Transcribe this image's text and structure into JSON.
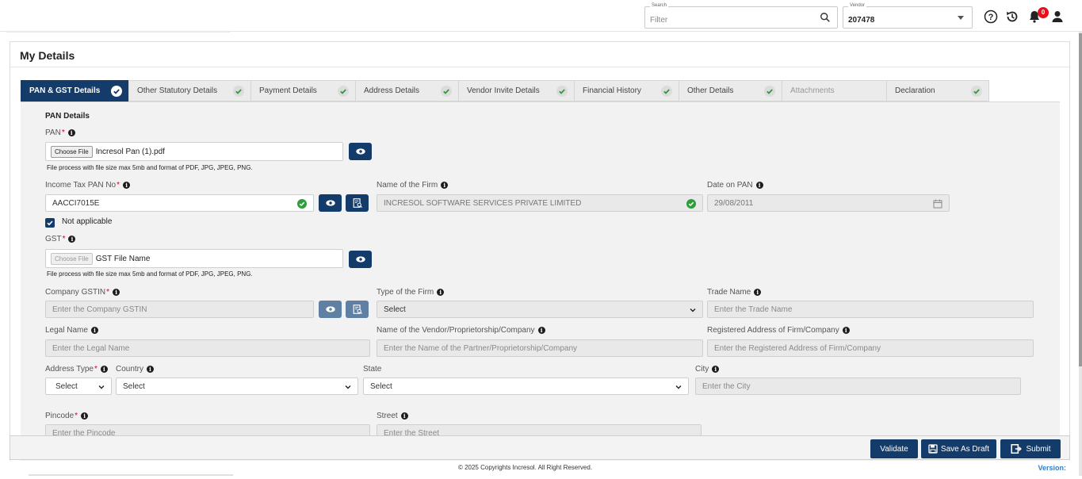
{
  "header": {
    "search": {
      "label": "Search",
      "placeholder": "Filter"
    },
    "vendor": {
      "label": "Vendor",
      "value": "207478"
    },
    "notification_count": "0"
  },
  "page": {
    "title": "My Details"
  },
  "tabs": [
    {
      "label": "PAN & GST Details",
      "state": "active"
    },
    {
      "label": "Other Statutory Details",
      "state": "done"
    },
    {
      "label": "Payment Details",
      "state": "done"
    },
    {
      "label": "Address Details",
      "state": "done"
    },
    {
      "label": "Vendor Invite Details",
      "state": "done"
    },
    {
      "label": "Financial History",
      "state": "done"
    },
    {
      "label": "Other Details",
      "state": "done"
    },
    {
      "label": "Attachments",
      "state": "disabled"
    },
    {
      "label": "Declaration",
      "state": "done"
    }
  ],
  "form": {
    "section_title": "PAN Details",
    "pan": {
      "label": "PAN",
      "choose_file": "Choose File",
      "file_name": "Incresol Pan (1).pdf",
      "hint": "File process with file size max 5mb and format of PDF, JPG, JPEG, PNG."
    },
    "income_tax_pan": {
      "label": "Income Tax PAN No",
      "value": "AACCI7015E"
    },
    "firm_name": {
      "label": "Name of the Firm",
      "value": "INCRESOL SOFTWARE SERVICES PRIVATE LIMITED"
    },
    "date_on_pan": {
      "label": "Date on PAN",
      "value": "29/08/2011"
    },
    "not_applicable": {
      "label": "Not applicable",
      "checked": true
    },
    "gst": {
      "label": "GST",
      "choose_file": "Choose File",
      "file_name": "GST File Name",
      "hint": "File process with file size max 5mb and format of PDF, JPG, JPEG, PNG."
    },
    "company_gstin": {
      "label": "Company GSTIN",
      "placeholder": "Enter the Company GSTIN"
    },
    "type_of_firm": {
      "label": "Type of the Firm",
      "value": "Select"
    },
    "trade_name": {
      "label": "Trade Name",
      "placeholder": "Enter the Trade Name"
    },
    "legal_name": {
      "label": "Legal Name",
      "placeholder": "Enter the Legal Name"
    },
    "vendor_name": {
      "label": "Name of the Vendor/Proprietorship/Company",
      "placeholder": "Enter the Name of the Partner/Proprietorship/Company"
    },
    "registered_address": {
      "label": "Registered Address of Firm/Company",
      "placeholder": "Enter the Registered Address of Firm/Company"
    },
    "address_type": {
      "label": "Address Type",
      "value": "Select"
    },
    "country": {
      "label": "Country",
      "value": "Select"
    },
    "state": {
      "label": "State",
      "value": "Select"
    },
    "city": {
      "label": "City",
      "placeholder": "Enter the City"
    },
    "pincode": {
      "label": "Pincode",
      "placeholder": "Enter the Pincode"
    },
    "street": {
      "label": "Street",
      "placeholder": "Enter the Street"
    }
  },
  "actions": {
    "validate": "Validate",
    "save_draft": "Save As Draft",
    "submit": "Submit"
  },
  "footer": {
    "copyright": "© 2025 Copyrights Incresol. All Right Reserved.",
    "version": "Version:"
  },
  "colors": {
    "primary": "#143c6b",
    "success": "#2e9e3a",
    "danger": "#e8101a"
  }
}
